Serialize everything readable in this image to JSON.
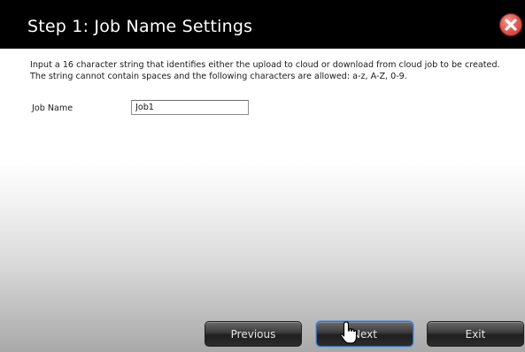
{
  "dialog": {
    "title": "Step 1: Job Name Settings",
    "close_icon": "close-circle-icon"
  },
  "content": {
    "description": "Input a 16 character string that identifies either the upload to cloud or download from cloud job to be created. The string cannot contain spaces and the following characters are allowed: a-z, A-Z, 0-9.",
    "job_name_label": "Job Name",
    "job_name_value": "Job1"
  },
  "footer": {
    "previous_label": "Previous",
    "next_label": "Next",
    "exit_label": "Exit"
  },
  "colors": {
    "titlebar": "#000000",
    "close": "#d9534f",
    "next_focus": "#6fa4e0"
  },
  "cursor_icon": "hand-pointer-icon"
}
